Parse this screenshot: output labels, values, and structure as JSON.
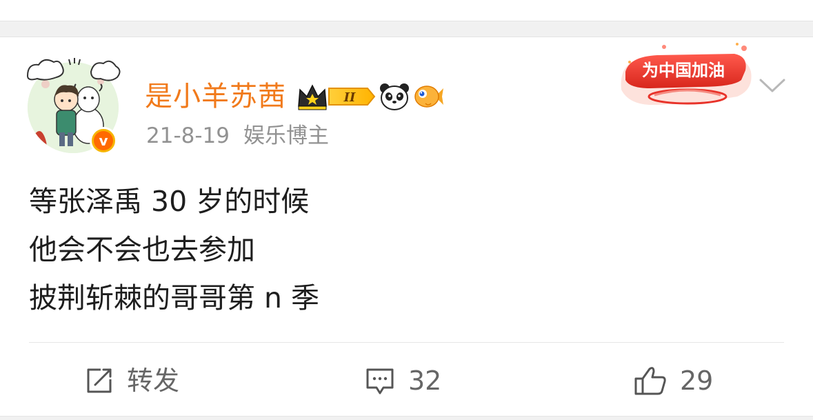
{
  "post": {
    "username": "是小羊苏茜",
    "date": "21-8-19",
    "identity": "娱乐博主",
    "content": "等张泽禹 30 岁的时候\n他会不会也去参加\n披荆斩棘的哥哥第 n 季",
    "verified_badge_glyph": "v",
    "level_badge_text": "II",
    "promo_text": "为中国加油"
  },
  "actions": {
    "repost_label": "转发",
    "comment_count": "32",
    "like_count": "29"
  },
  "colors": {
    "username": "#f17a1b",
    "meta": "#929292",
    "action": "#666666",
    "promo": "#e8332a"
  },
  "icons": {
    "repost": "share-edit-icon",
    "comment": "comment-icon",
    "like": "thumbs-up-icon",
    "more": "chevron-down-icon",
    "crown": "crown-icon",
    "panda": "panda-icon",
    "fish": "goldfish-icon"
  }
}
